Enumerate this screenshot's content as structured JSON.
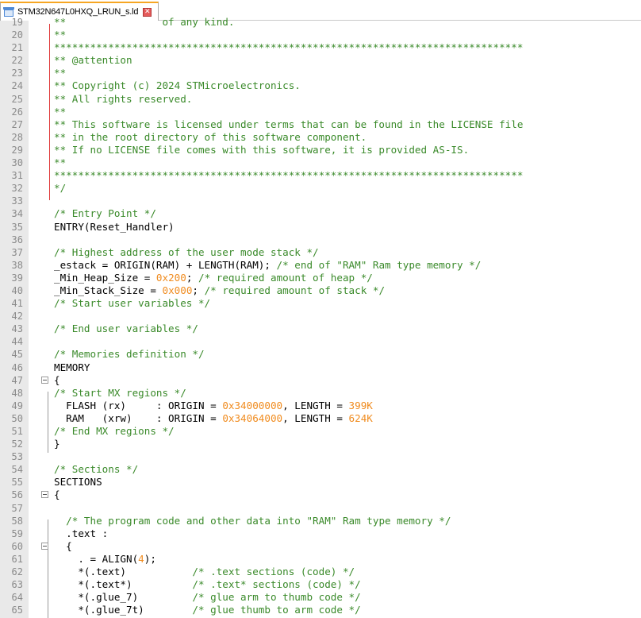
{
  "tab": {
    "title": "STM32N647L0HXQ_LRUN_s.ld",
    "icon": "file-document-icon",
    "close_icon": "close-icon"
  },
  "colors": {
    "comment": "#3a8a2a",
    "number": "#f08c20",
    "text": "#000000",
    "line_number": "#8a8a8a",
    "gutter_bg": "#e9e9e9",
    "fold_marker": "#e03a3a"
  },
  "lines": [
    {
      "n": "19",
      "segs": [
        {
          "t": "**                of any kind.",
          "c": "c"
        }
      ]
    },
    {
      "n": "20",
      "segs": [
        {
          "t": "**",
          "c": "c"
        }
      ]
    },
    {
      "n": "21",
      "segs": [
        {
          "t": "******************************************************************************",
          "c": "c"
        }
      ]
    },
    {
      "n": "22",
      "segs": [
        {
          "t": "** @attention",
          "c": "c"
        }
      ]
    },
    {
      "n": "23",
      "segs": [
        {
          "t": "**",
          "c": "c"
        }
      ]
    },
    {
      "n": "24",
      "segs": [
        {
          "t": "** Copyright (c) 2024 STMicroelectronics.",
          "c": "c"
        }
      ]
    },
    {
      "n": "25",
      "segs": [
        {
          "t": "** All rights reserved.",
          "c": "c"
        }
      ]
    },
    {
      "n": "26",
      "segs": [
        {
          "t": "**",
          "c": "c"
        }
      ]
    },
    {
      "n": "27",
      "segs": [
        {
          "t": "** This software is licensed under terms that can be found in the LICENSE file",
          "c": "c"
        }
      ]
    },
    {
      "n": "28",
      "segs": [
        {
          "t": "** in the root directory of this software component.",
          "c": "c"
        }
      ]
    },
    {
      "n": "29",
      "segs": [
        {
          "t": "** If no LICENSE file comes with this software, it is provided AS-IS.",
          "c": "c"
        }
      ]
    },
    {
      "n": "30",
      "segs": [
        {
          "t": "**",
          "c": "c"
        }
      ]
    },
    {
      "n": "31",
      "segs": [
        {
          "t": "******************************************************************************",
          "c": "c"
        }
      ]
    },
    {
      "n": "32",
      "segs": [
        {
          "t": "*/",
          "c": "c"
        }
      ]
    },
    {
      "n": "33",
      "segs": []
    },
    {
      "n": "34",
      "segs": [
        {
          "t": "/* Entry Point */",
          "c": "c"
        }
      ]
    },
    {
      "n": "35",
      "segs": [
        {
          "t": "ENTRY(Reset_Handler)",
          "c": ""
        }
      ]
    },
    {
      "n": "36",
      "segs": []
    },
    {
      "n": "37",
      "segs": [
        {
          "t": "/* Highest address of the user mode stack */",
          "c": "c"
        }
      ]
    },
    {
      "n": "38",
      "segs": [
        {
          "t": "_estack = ORIGIN(RAM) + LENGTH(RAM); ",
          "c": ""
        },
        {
          "t": "/* end of \"RAM\" Ram type memory */",
          "c": "c"
        }
      ]
    },
    {
      "n": "39",
      "segs": [
        {
          "t": "_Min_Heap_Size = ",
          "c": ""
        },
        {
          "t": "0x200",
          "c": "n"
        },
        {
          "t": "; ",
          "c": ""
        },
        {
          "t": "/* required amount of heap */",
          "c": "c"
        }
      ]
    },
    {
      "n": "40",
      "segs": [
        {
          "t": "_Min_Stack_Size = ",
          "c": ""
        },
        {
          "t": "0x000",
          "c": "n"
        },
        {
          "t": "; ",
          "c": ""
        },
        {
          "t": "/* required amount of stack */",
          "c": "c"
        }
      ]
    },
    {
      "n": "41",
      "segs": [
        {
          "t": "/* Start user variables */",
          "c": "c"
        }
      ]
    },
    {
      "n": "42",
      "segs": []
    },
    {
      "n": "43",
      "segs": [
        {
          "t": "/* End user variables */",
          "c": "c"
        }
      ]
    },
    {
      "n": "44",
      "segs": []
    },
    {
      "n": "45",
      "segs": [
        {
          "t": "/* Memories definition */",
          "c": "c"
        }
      ]
    },
    {
      "n": "46",
      "segs": [
        {
          "t": "MEMORY",
          "c": ""
        }
      ]
    },
    {
      "n": "47",
      "segs": [
        {
          "t": "{",
          "c": ""
        }
      ]
    },
    {
      "n": "48",
      "segs": [
        {
          "t": "/* Start MX regions */",
          "c": "c"
        }
      ]
    },
    {
      "n": "49",
      "segs": [
        {
          "t": "  FLASH (rx)     : ORIGIN = ",
          "c": ""
        },
        {
          "t": "0x34000000",
          "c": "n"
        },
        {
          "t": ", LENGTH = ",
          "c": ""
        },
        {
          "t": "399K",
          "c": "n"
        }
      ]
    },
    {
      "n": "50",
      "segs": [
        {
          "t": "  RAM   (xrw)    : ORIGIN = ",
          "c": ""
        },
        {
          "t": "0x34064000",
          "c": "n"
        },
        {
          "t": ", LENGTH = ",
          "c": ""
        },
        {
          "t": "624K",
          "c": "n"
        }
      ]
    },
    {
      "n": "51",
      "segs": [
        {
          "t": "/* End MX regions */",
          "c": "c"
        }
      ]
    },
    {
      "n": "52",
      "segs": [
        {
          "t": "}",
          "c": ""
        }
      ]
    },
    {
      "n": "53",
      "segs": []
    },
    {
      "n": "54",
      "segs": [
        {
          "t": "/* Sections */",
          "c": "c"
        }
      ]
    },
    {
      "n": "55",
      "segs": [
        {
          "t": "SECTIONS",
          "c": ""
        }
      ]
    },
    {
      "n": "56",
      "segs": [
        {
          "t": "{",
          "c": ""
        }
      ]
    },
    {
      "n": "57",
      "segs": []
    },
    {
      "n": "58",
      "segs": [
        {
          "t": "  ",
          "c": ""
        },
        {
          "t": "/* The program code and other data into \"RAM\" Ram type memory */",
          "c": "c"
        }
      ]
    },
    {
      "n": "59",
      "segs": [
        {
          "t": "  .text :",
          "c": ""
        }
      ]
    },
    {
      "n": "60",
      "segs": [
        {
          "t": "  {",
          "c": ""
        }
      ]
    },
    {
      "n": "61",
      "segs": [
        {
          "t": "    . = ALIGN(",
          "c": ""
        },
        {
          "t": "4",
          "c": "n"
        },
        {
          "t": ");",
          "c": ""
        }
      ]
    },
    {
      "n": "62",
      "segs": [
        {
          "t": "    *(.text)           ",
          "c": ""
        },
        {
          "t": "/* .text sections (code) */",
          "c": "c"
        }
      ]
    },
    {
      "n": "63",
      "segs": [
        {
          "t": "    *(.text*)          ",
          "c": ""
        },
        {
          "t": "/* .text* sections (code) */",
          "c": "c"
        }
      ]
    },
    {
      "n": "64",
      "segs": [
        {
          "t": "    *(.glue_7)         ",
          "c": ""
        },
        {
          "t": "/* glue arm to thumb code */",
          "c": "c"
        }
      ]
    },
    {
      "n": "65",
      "segs": [
        {
          "t": "    *(.glue_7t)        ",
          "c": ""
        },
        {
          "t": "/* glue thumb to arm code */",
          "c": "c"
        }
      ]
    }
  ]
}
